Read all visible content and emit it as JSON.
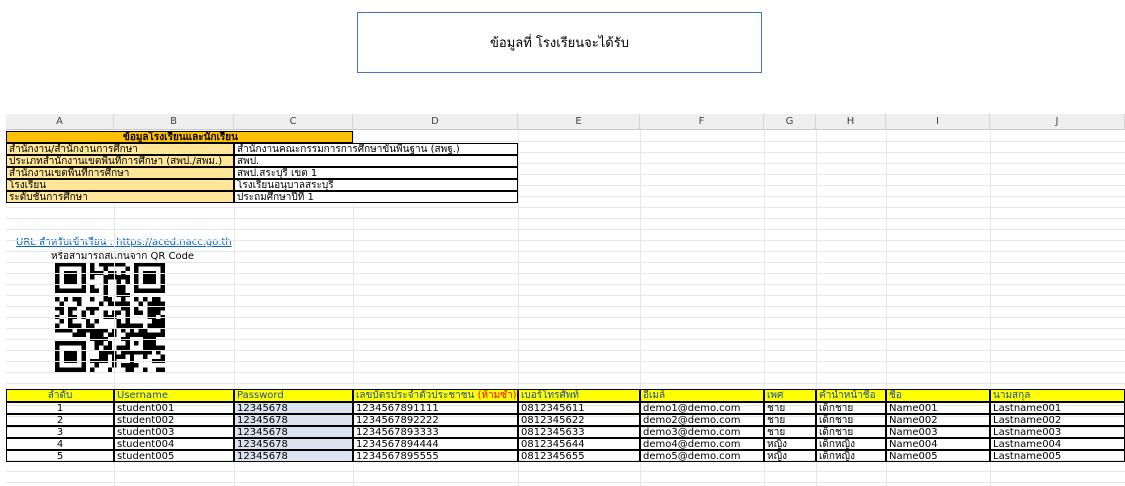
{
  "callout": "ข้อมูลที่ โรงเรียนจะได้รับ",
  "columns": [
    "A",
    "B",
    "C",
    "D",
    "E",
    "F",
    "G",
    "H",
    "I",
    "J"
  ],
  "info": {
    "title": "ข้อมูลโรงเรียนและนักเรียน",
    "rows": [
      {
        "label": "สำนักงาน/สำนักงานการศึกษา",
        "value": "สำนักงานคณะกรรมการการศึกษาขั้นพื้นฐาน (สพฐ.)"
      },
      {
        "label": "ประเภทสำนักงานเขตพื้นที่การศึกษา (สพป./สพม.)",
        "value": "สพป."
      },
      {
        "label": "สำนักงานเขตพื้นที่การศึกษา",
        "value": "สพป.สระบุรี เขต 1"
      },
      {
        "label": "โรงเรียน",
        "value": "โรงเรียนอนุบาลสระบุรี"
      },
      {
        "label": "ระดับชั้นการศึกษา",
        "value": "ประถมศึกษาปีที่ 1"
      }
    ]
  },
  "link": "URL สำหรับเข้าเรียน : https://aced.nacc.go.th",
  "qr_caption": "หรือสามารถสแกนจาก QR Code",
  "table": {
    "headers": [
      "ลำดับ",
      "Username",
      "Password",
      "เลขบัตรประจำตัวประชาชน",
      "เบอร์โทรศัพท์",
      "อีเมล์",
      "เพศ",
      "คำนำหน้าชื่อ",
      "ชื่อ",
      "นามสกุล"
    ],
    "id_note": "(ห้ามซ้ำ)",
    "rows": [
      [
        "1",
        "student001",
        "12345678",
        "1234567891111",
        "0812345611",
        "demo1@demo.com",
        "ชาย",
        "เด็กชาย",
        "Name001",
        "Lastname001"
      ],
      [
        "2",
        "student002",
        "12345678",
        "1234567892222",
        "0812345622",
        "demo2@demo.com",
        "ชาย",
        "เด็กชาย",
        "Name002",
        "Lastname002"
      ],
      [
        "3",
        "student003",
        "12345678",
        "1234567893333",
        "0812345633",
        "demo3@demo.com",
        "ชาย",
        "เด็กชาย",
        "Name003",
        "Lastname003"
      ],
      [
        "4",
        "student004",
        "12345678",
        "1234567894444",
        "0812345644",
        "demo4@demo.com",
        "หญิง",
        "เด็กหญิง",
        "Name004",
        "Lastname004"
      ],
      [
        "5",
        "student005",
        "12345678",
        "1234567895555",
        "0812345655",
        "demo5@demo.com",
        "หญิง",
        "เด็กหญิง",
        "Name005",
        "Lastname005"
      ]
    ]
  }
}
